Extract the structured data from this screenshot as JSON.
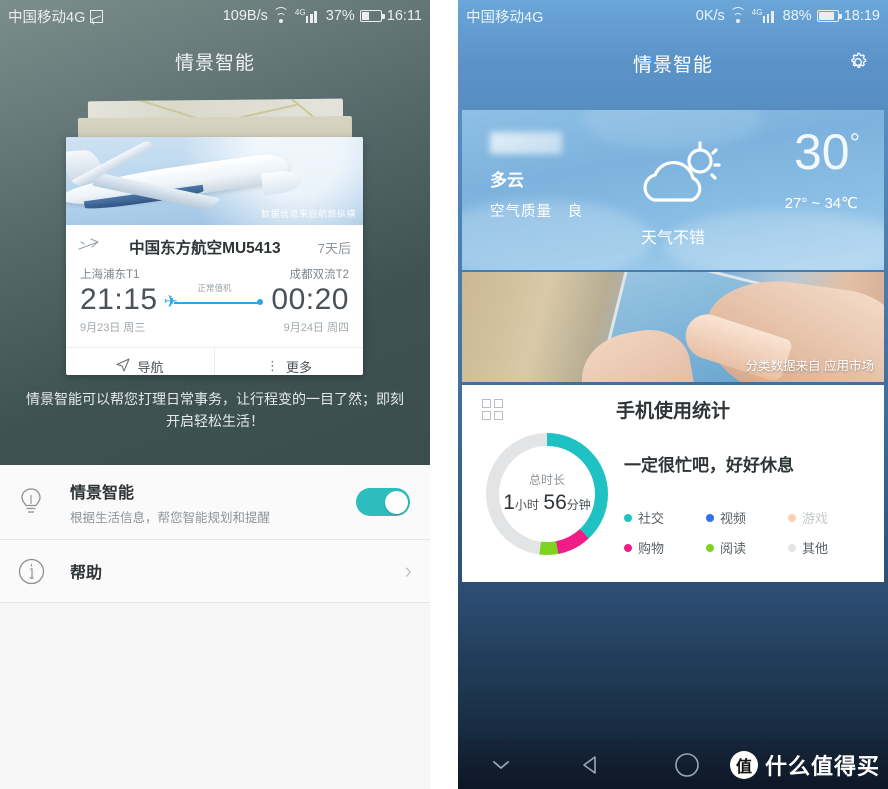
{
  "left": {
    "statusbar": {
      "carrier": "中国移动4G",
      "net_speed": "109B/s",
      "battery": "37%",
      "time": "16:11"
    },
    "title": "情景智能",
    "flight_card": {
      "photo_caption": "数据信息来自航旅纵横",
      "airline_flight": "中国东方航空MU5413",
      "countdown": "7天后",
      "depart_airport": "上海浦东T1",
      "depart_time": "21:15",
      "status": "正常值机",
      "arrive_airport": "成都双流T2",
      "arrive_time": "00:20",
      "depart_date": "9月23日 周三",
      "arrive_date": "9月24日 周四",
      "action_nav": "导航",
      "action_more": "更多"
    },
    "description": "情景智能可以帮您打理日常事务，让行程变的一目了然；即刻开启轻松生活！",
    "settings": [
      {
        "title": "情景智能",
        "subtitle": "根据生活信息，帮您智能规划和提醒",
        "toggle_on": "开"
      },
      {
        "title": "帮助",
        "subtitle": ""
      }
    ],
    "toggle_color": "#2dbdbd"
  },
  "right": {
    "statusbar": {
      "carrier": "中国移动4G",
      "net_speed": "0K/s",
      "battery": "88%",
      "time": "18:19"
    },
    "title": "情景智能",
    "weather": {
      "city": "",
      "condition": "多云",
      "air_quality": "空气质量　良",
      "temp": "30",
      "temp_unit": "°",
      "range": "27° ~ 34℃",
      "message": "天气不错"
    },
    "photo_caption": "分类数据来自 应用市场",
    "usage": {
      "title": "手机使用统计",
      "total_label": "总时长",
      "hours": "1",
      "hours_unit": "小时",
      "minutes": "56",
      "minutes_unit": "分钟",
      "message": "一定很忙吧，好好休息"
    },
    "navbar": {
      "watermark_badge": "值",
      "watermark_text": "什么值得买"
    }
  },
  "chart_data": {
    "type": "pie",
    "title": "手机使用统计",
    "subtitle": "总时长 1 小时 56 分钟",
    "categories": [
      "社交",
      "视频",
      "游戏",
      "购物",
      "阅读",
      "其他"
    ],
    "values": [
      38,
      0,
      0,
      9,
      5,
      48
    ],
    "unit": "percent",
    "colors": [
      "#1fc2c2",
      "#2f6ff0",
      "#ffcfae",
      "#f11d86",
      "#7ed321",
      "#e2e4e6"
    ],
    "legend": "right",
    "inner_label": "总时长 1小时 56分钟"
  }
}
